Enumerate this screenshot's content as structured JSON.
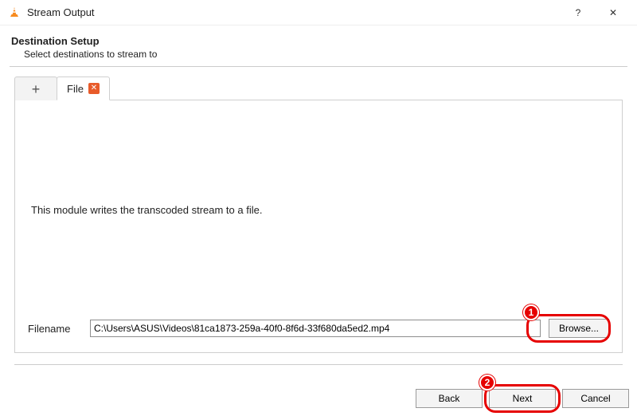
{
  "window": {
    "title": "Stream Output",
    "help_glyph": "?",
    "close_glyph": "✕"
  },
  "section": {
    "heading": "Destination Setup",
    "sub": "Select destinations to stream to"
  },
  "tabs": {
    "add_glyph": "+",
    "file_label": "File",
    "close_glyph": "✕"
  },
  "panel": {
    "module_desc": "This module writes the transcoded stream to a file.",
    "filename_label": "Filename",
    "filename_value": "C:\\Users\\ASUS\\Videos\\81ca1873-259a-40f0-8f6d-33f680da5ed2.mp4",
    "browse_label": "Browse..."
  },
  "footer": {
    "back": "Back",
    "next": "Next",
    "cancel": "Cancel"
  },
  "annotations": {
    "badge1": "1",
    "badge2": "2"
  }
}
